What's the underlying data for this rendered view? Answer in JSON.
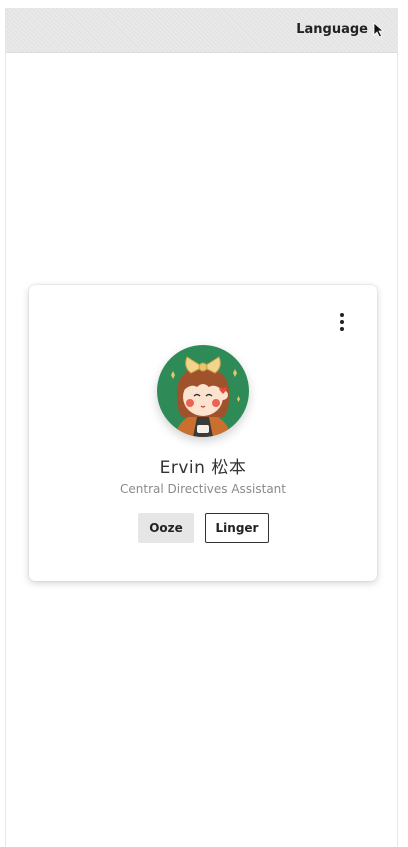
{
  "header": {
    "language_label": "Language"
  },
  "profile": {
    "name": "Ervin 松本",
    "title": "Central Directives Assistant",
    "avatar_icon": "cartoon-girl-avatar"
  },
  "actions": {
    "primary_label": "Ooze",
    "secondary_label": "Linger"
  },
  "menu": {
    "icon": "kebab-menu-icon"
  },
  "colors": {
    "avatar_bg": "#2e8b57",
    "card_bg": "#ffffff",
    "primary_button_bg": "#e6e6e6"
  }
}
